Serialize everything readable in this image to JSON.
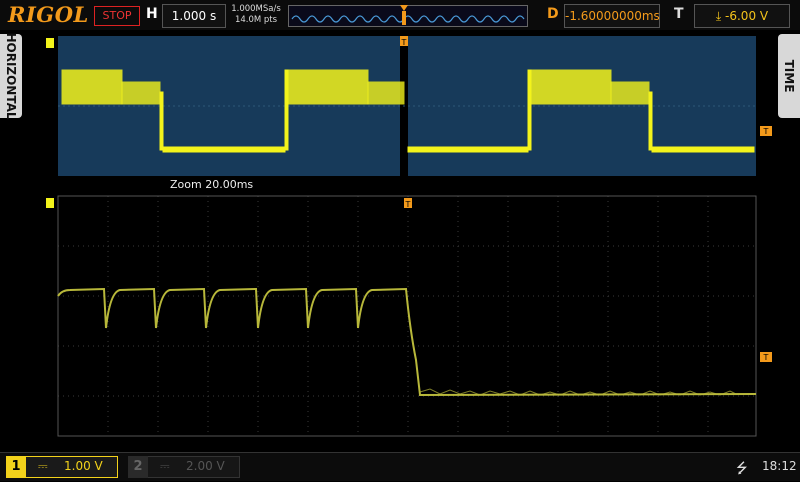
{
  "topbar": {
    "brand": "RIGOL",
    "run_state": "STOP",
    "h_label": "H",
    "timebase": "1.000 s",
    "sample_rate": "1.000MSa/s",
    "mem_depth": "14.0M pts",
    "d_label": "D",
    "delay": "-1.60000000ms",
    "t_label": "T",
    "trigger_level": "-6.00 V",
    "trigger_slope_icon": "falling-edge-icon"
  },
  "side_tabs": {
    "left": "HORIZONTAL",
    "right": "TIME"
  },
  "zoom_label": "Zoom  20.00ms",
  "channels": [
    {
      "number": "1",
      "coupling_icon": "dc-coupling-icon",
      "scale": "1.00 V",
      "active": true,
      "color": "#f3d21b"
    },
    {
      "number": "2",
      "coupling_icon": "dc-coupling-icon",
      "scale": "2.00 V",
      "active": false,
      "color": "#555555"
    }
  ],
  "status": {
    "usb_icon": "usb-icon",
    "time": "18:12"
  },
  "colors": {
    "accent_orange": "#f39a1b",
    "trace_yellow": "#f3f31b",
    "zoom_trace": "#b8b83a",
    "overview_bg": "#173a5a"
  },
  "markers": {
    "trigger_position_marker": "T",
    "trigger_level_marker": "T"
  }
}
